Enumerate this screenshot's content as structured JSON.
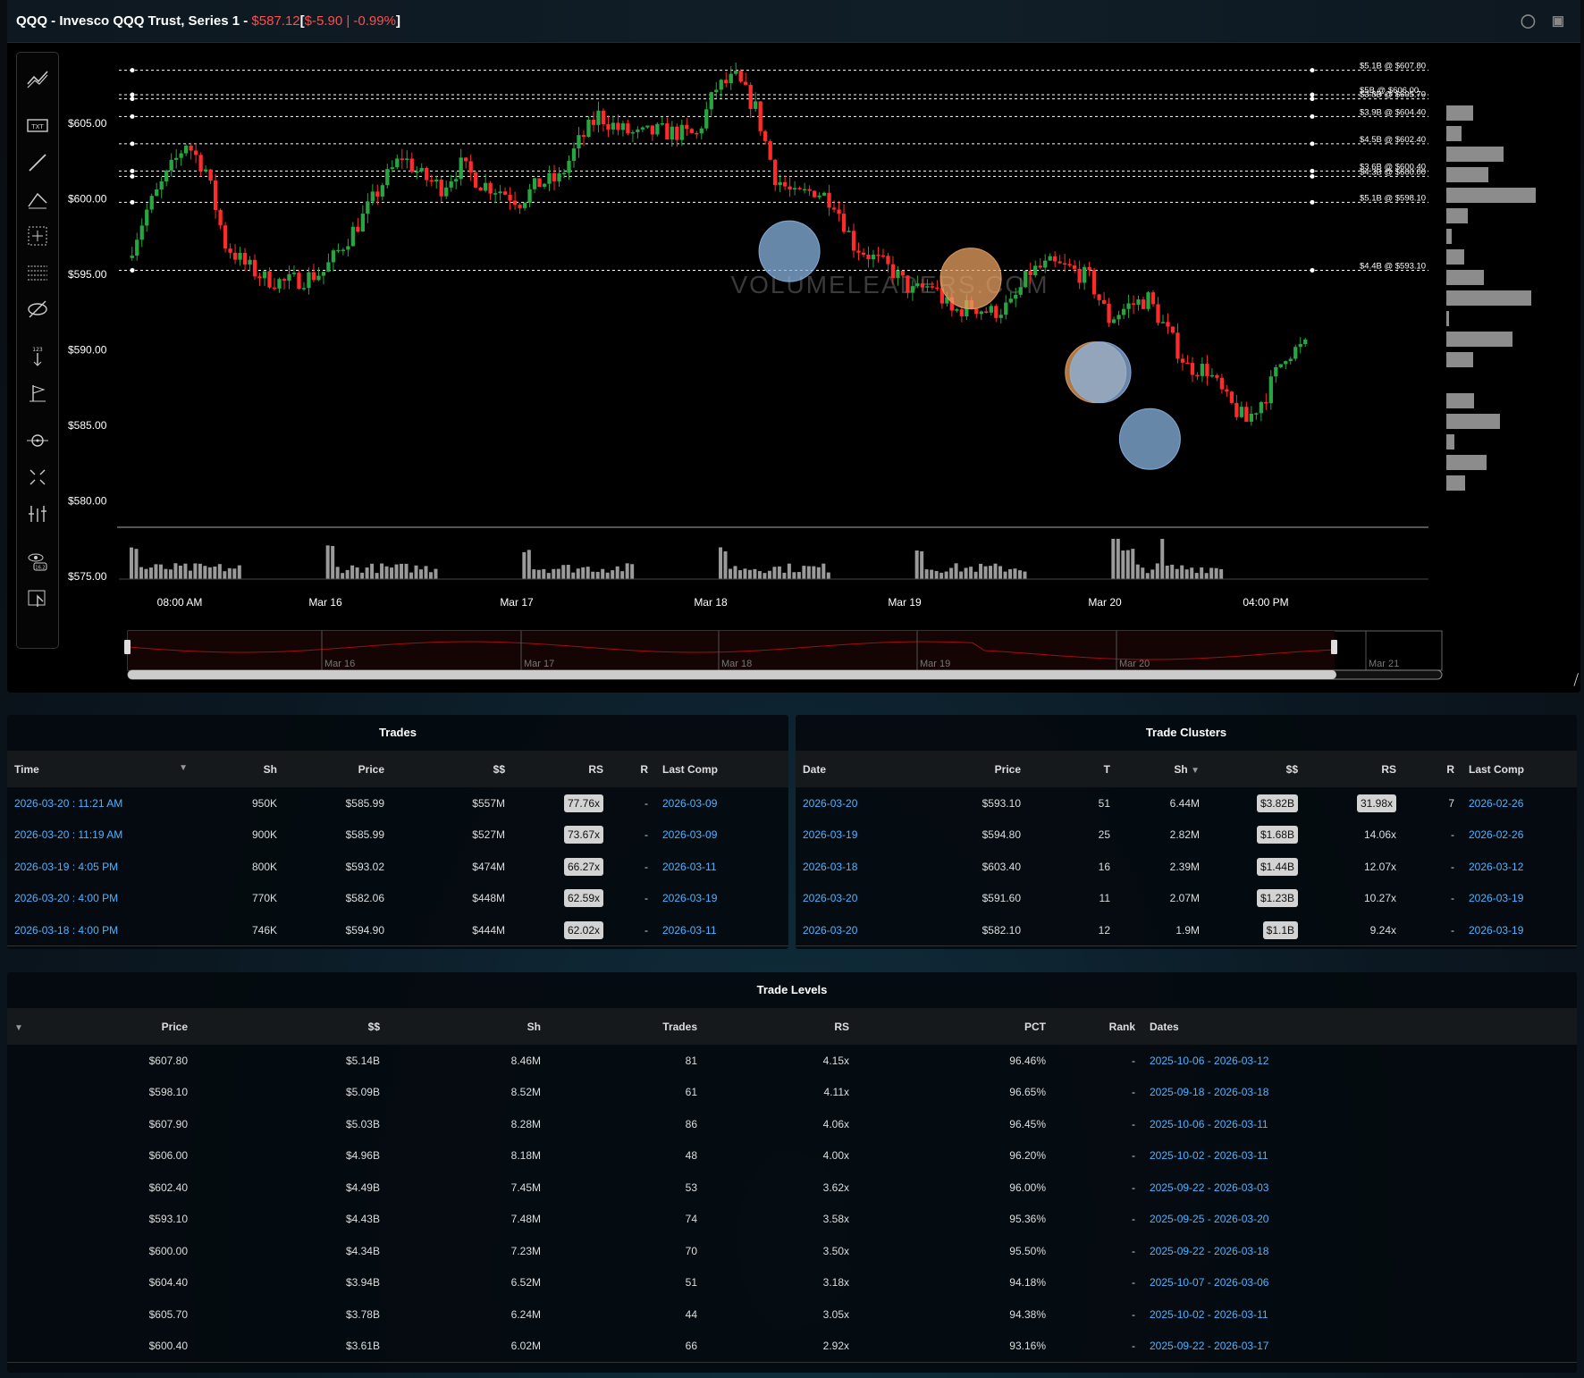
{
  "header": {
    "symbol_title": "QQQ - Invesco QQQ Trust, Series 1 - ",
    "price": "$587.12",
    "change_open": " [ ",
    "change": "$-5.90 | -0.99%",
    "change_close": " ]"
  },
  "toolbar": {
    "tools": [
      "trend-lines",
      "text",
      "line",
      "pattern",
      "crosshair-box",
      "fib-levels",
      "hide-drawings",
      "measure",
      "flag",
      "zoom-target",
      "expand",
      "settings-bars",
      "view-icon",
      "export"
    ]
  },
  "chart_data": {
    "type": "candlestick",
    "title": "",
    "watermark": "VOLUMELEADERS.COM",
    "y_ticks": [
      "$605.00",
      "$600.00",
      "$595.00",
      "$590.00",
      "$585.00",
      "$580.00",
      "$575.00"
    ],
    "ylim": [
      575,
      608.5
    ],
    "x_ticks": [
      "08:00 AM",
      "Mar 16",
      "Mar 17",
      "Mar 18",
      "Mar 19",
      "Mar 20",
      "04:00 PM"
    ],
    "navigator_labels": [
      "Mar 16",
      "Mar 17",
      "Mar 18",
      "Mar 19",
      "Mar 20",
      "Mar 21"
    ],
    "levels": [
      {
        "label": "$5.1B @ $607.80",
        "price": 607.8
      },
      {
        "label": "$5B @ $606.00",
        "price": 606.0
      },
      {
        "label": "$3.8B @ $605.70",
        "price": 605.7
      },
      {
        "label": "$3.9B @ $604.40",
        "price": 604.4
      },
      {
        "label": "$4.5B @ $602.40",
        "price": 602.4
      },
      {
        "label": "$3.6B @ $600.40",
        "price": 600.4
      },
      {
        "label": "$4.3B @ $600.00",
        "price": 600.0
      },
      {
        "label": "$5.1B @ $598.10",
        "price": 598.1
      },
      {
        "label": "$4.4B @ $593.10",
        "price": 593.1
      }
    ],
    "bubbles": [
      {
        "x_frac": 0.56,
        "price": 594.5,
        "color": "#8ab4e0"
      },
      {
        "x_frac": 0.714,
        "price": 592.5,
        "color": "#e8a060"
      },
      {
        "x_frac": 0.82,
        "price": 585.6,
        "color": "#e8a060"
      },
      {
        "x_frac": 0.824,
        "price": 585.6,
        "color": "#8ab4e0"
      },
      {
        "x_frac": 0.866,
        "price": 580.7,
        "color": "#8ab4e0"
      }
    ],
    "path": [
      594,
      597.5,
      600,
      602.5,
      600.5,
      595,
      593.5,
      592.5,
      592.2,
      592.5,
      593,
      595,
      597,
      599.5,
      601.5,
      600,
      599.2,
      600.8,
      599.5,
      599,
      598.2,
      599.5,
      599.8,
      602.5,
      604.5,
      603.5,
      603,
      603.3,
      603.2,
      603,
      606.5,
      607.2,
      605,
      600,
      598.5,
      599,
      598.2,
      595,
      594,
      593,
      591.5,
      592,
      590,
      590.5,
      590,
      590.5,
      593,
      593.5,
      593.2,
      592.5,
      589.5,
      590.5,
      591,
      588.5,
      586,
      585.8,
      583.5,
      582,
      584,
      587,
      587.5
    ],
    "profile_bars": [
      0.3,
      0.17,
      0.64,
      0.47,
      1.0,
      0.24,
      0.06,
      0.2,
      0.42,
      0.95,
      0.02,
      0.74,
      0.3,
      0.0,
      0.31,
      0.6,
      0.09,
      0.45,
      0.21
    ],
    "volume": [
      0.08,
      0.25,
      0.15,
      0.2,
      0.05,
      0.12,
      0.18,
      0.2,
      0.3,
      0.22,
      0.12,
      0.15,
      0.45,
      0.35,
      0.9,
      0.6,
      1.0,
      0.2
    ]
  },
  "trades": {
    "title": "Trades",
    "columns": [
      "Time",
      "Sh",
      "Price",
      "$$",
      "RS",
      "R",
      "Last Comp"
    ],
    "rows": [
      [
        "2026-03-20 : 11:21 AM",
        "950K",
        "$585.99",
        "$557M",
        "77.76x",
        "-",
        "2026-03-09"
      ],
      [
        "2026-03-20 : 11:19 AM",
        "900K",
        "$585.99",
        "$527M",
        "73.67x",
        "-",
        "2026-03-09"
      ],
      [
        "2026-03-19 : 4:05 PM",
        "800K",
        "$593.02",
        "$474M",
        "66.27x",
        "-",
        "2026-03-11"
      ],
      [
        "2026-03-20 : 4:00 PM",
        "770K",
        "$582.06",
        "$448M",
        "62.59x",
        "-",
        "2026-03-19"
      ],
      [
        "2026-03-18 : 4:00 PM",
        "746K",
        "$594.90",
        "$444M",
        "62.02x",
        "-",
        "2026-03-11"
      ]
    ]
  },
  "clusters": {
    "title": "Trade Clusters",
    "columns": [
      "Date",
      "Price",
      "T",
      "Sh",
      "$$",
      "RS",
      "R",
      "Last Comp"
    ],
    "rows": [
      [
        "2026-03-20",
        "$593.10",
        "51",
        "6.44M",
        "$3.82B",
        "31.98x",
        "7",
        "2026-02-26"
      ],
      [
        "2026-03-19",
        "$594.80",
        "25",
        "2.82M",
        "$1.68B",
        "14.06x",
        "-",
        "2026-02-26"
      ],
      [
        "2026-03-18",
        "$603.40",
        "16",
        "2.39M",
        "$1.44B",
        "12.07x",
        "-",
        "2026-03-12"
      ],
      [
        "2026-03-20",
        "$591.60",
        "11",
        "2.07M",
        "$1.23B",
        "10.27x",
        "-",
        "2026-03-19"
      ],
      [
        "2026-03-20",
        "$582.10",
        "12",
        "1.9M",
        "$1.1B",
        "9.24x",
        "-",
        "2026-03-19"
      ]
    ]
  },
  "levels_table": {
    "title": "Trade Levels",
    "columns": [
      "Price",
      "$$",
      "Sh",
      "Trades",
      "RS",
      "PCT",
      "Rank",
      "Dates"
    ],
    "rows": [
      [
        "$607.80",
        "$5.14B",
        "8.46M",
        "81",
        "4.15x",
        "96.46%",
        "-",
        "2025-10-06 - 2026-03-12"
      ],
      [
        "$598.10",
        "$5.09B",
        "8.52M",
        "61",
        "4.11x",
        "96.65%",
        "-",
        "2025-09-18 - 2026-03-18"
      ],
      [
        "$607.90",
        "$5.03B",
        "8.28M",
        "86",
        "4.06x",
        "96.45%",
        "-",
        "2025-10-06 - 2026-03-11"
      ],
      [
        "$606.00",
        "$4.96B",
        "8.18M",
        "48",
        "4.00x",
        "96.20%",
        "-",
        "2025-10-02 - 2026-03-11"
      ],
      [
        "$602.40",
        "$4.49B",
        "7.45M",
        "53",
        "3.62x",
        "96.00%",
        "-",
        "2025-09-22 - 2026-03-03"
      ],
      [
        "$593.10",
        "$4.43B",
        "7.48M",
        "74",
        "3.58x",
        "95.36%",
        "-",
        "2025-09-25 - 2026-03-20"
      ],
      [
        "$600.00",
        "$4.34B",
        "7.23M",
        "70",
        "3.50x",
        "95.50%",
        "-",
        "2025-09-22 - 2026-03-18"
      ],
      [
        "$604.40",
        "$3.94B",
        "6.52M",
        "51",
        "3.18x",
        "94.18%",
        "-",
        "2025-10-07 - 2026-03-06"
      ],
      [
        "$605.70",
        "$3.78B",
        "6.24M",
        "44",
        "3.05x",
        "94.38%",
        "-",
        "2025-10-02 - 2026-03-11"
      ],
      [
        "$600.40",
        "$3.61B",
        "6.02M",
        "66",
        "2.92x",
        "93.16%",
        "-",
        "2025-09-22 - 2026-03-17"
      ]
    ]
  },
  "colors": {
    "up": "#26a641",
    "down": "#ff2b2b",
    "link": "#4fb3ff",
    "level_line": "#ffffff",
    "profile_bar": "#8c8c8c"
  }
}
